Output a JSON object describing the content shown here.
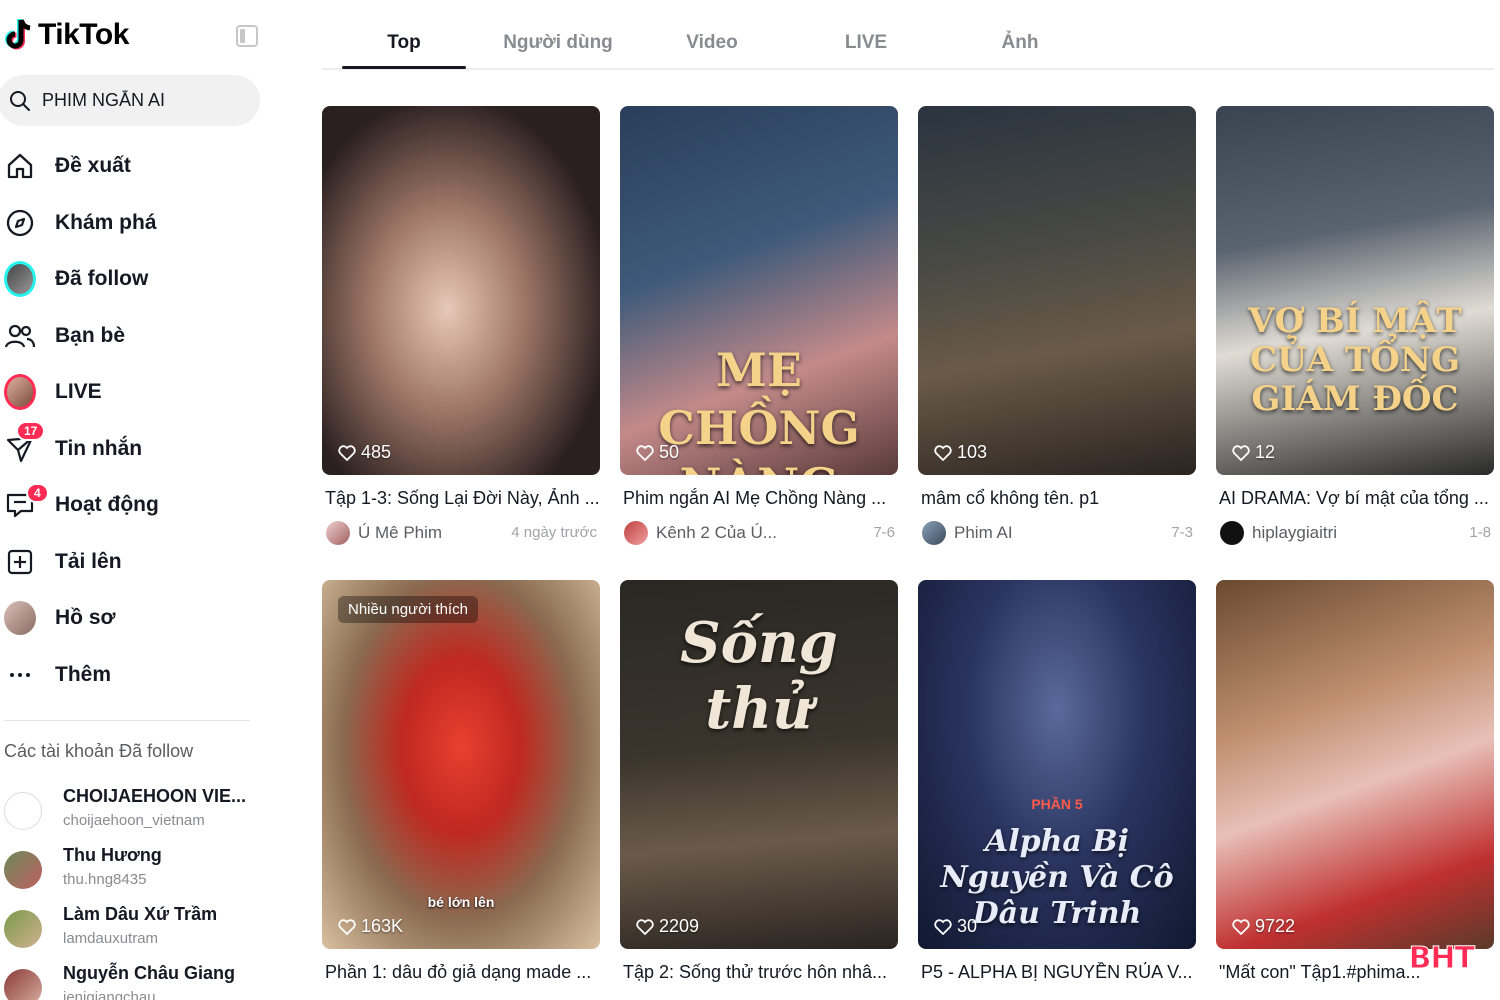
{
  "app": {
    "logo_text": "TikTok"
  },
  "search": {
    "value": "PHIM NGẮN AI",
    "icon": "search-icon"
  },
  "nav": [
    {
      "label": "Đề xuất",
      "icon": "home-icon"
    },
    {
      "label": "Khám phá",
      "icon": "compass-icon"
    },
    {
      "label": "Đã follow",
      "icon": "following-avatar"
    },
    {
      "label": "Bạn bè",
      "icon": "friends-icon"
    },
    {
      "label": "LIVE",
      "icon": "live-avatar"
    },
    {
      "label": "Tin nhắn",
      "icon": "inbox-icon",
      "badge": "17"
    },
    {
      "label": "Hoạt động",
      "icon": "activity-icon",
      "badge": "4"
    },
    {
      "label": "Tải lên",
      "icon": "upload-icon"
    },
    {
      "label": "Hồ sơ",
      "icon": "profile-avatar"
    },
    {
      "label": "Thêm",
      "icon": "more-icon"
    }
  ],
  "following": {
    "title": "Các tài khoản Đã follow",
    "accounts": [
      {
        "name": "CHOIJAEHOON VIE...",
        "username": "choijaehoon_vietnam"
      },
      {
        "name": "Thu Hương",
        "username": "thu.hng8435"
      },
      {
        "name": "Làm Dâu Xứ Trầm",
        "username": "lamdauxutram"
      },
      {
        "name": "Nguyễn Châu Giang",
        "username": "jenjgiangchau"
      }
    ]
  },
  "tabs": [
    "Top",
    "Người dùng",
    "Video",
    "LIVE",
    "Ảnh"
  ],
  "active_tab": "Top",
  "videos": [
    {
      "likes": "485",
      "caption": "Tập 1-3: Sống Lại Đời Này, Ảnh ...",
      "author": "Ú Mê Phim",
      "date": "4 ngày trước"
    },
    {
      "likes": "50",
      "caption": "Phim ngắn AI Mẹ Chồng Nàng ...",
      "author": "Kênh 2 Của Ú...",
      "date": "7-6",
      "overlay": "MẸ CHỒNG NÀNG DÂU"
    },
    {
      "likes": "103",
      "caption": "mâm cổ không tên. p1",
      "author": "Phim AI",
      "date": "7-3"
    },
    {
      "likes": "12",
      "caption": "AI DRAMA: Vợ bí mật của tổng ...",
      "author": "hiplaygiaitri",
      "date": "1-8",
      "overlay": "VỢ BÍ MẬT CỦA TỔNG GIÁM ĐỐC"
    },
    {
      "likes": "163K",
      "caption": "Phần 1: dâu đỏ giả dạng made ...",
      "tag": "Nhiều người thích",
      "subtitle": "bé lớn lên"
    },
    {
      "likes": "2209",
      "caption": "Tập 2: Sống thử trước hôn nhâ...",
      "overlay": "Sống thử"
    },
    {
      "likes": "30",
      "caption": "P5 - ALPHA BỊ NGUYỀN RỦA V...",
      "overlay": "Alpha Bị Nguyền Và Cô Dâu Trinh",
      "badge_text": "PHẦN 5"
    },
    {
      "likes": "9722",
      "caption": "\"Mất con\" Tập1.#phima..."
    }
  ],
  "watermark": "BHT"
}
